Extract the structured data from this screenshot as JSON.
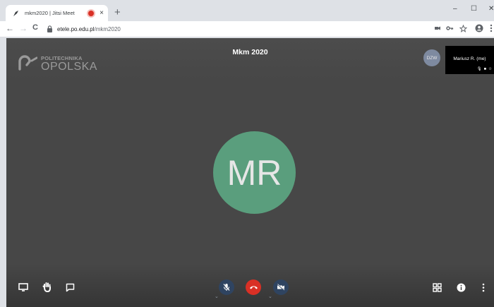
{
  "browser": {
    "tab_title": "mkm2020 | Jitsi Meet",
    "tab_close": "×",
    "new_tab": "+",
    "window_minimize": "–",
    "window_maximize": "☐",
    "window_close": "✕",
    "back": "←",
    "forward": "→",
    "reload": "C",
    "url_host": "etele.po.edu.pl",
    "url_path": "/mkm2020"
  },
  "meeting": {
    "logo_line1": "POLITECHNIKA",
    "logo_line2": "OPOLSKA",
    "title": "Mkm 2020",
    "local_initials": "DZW",
    "thumbnail_name": "Mariusz R. (me)",
    "speaker_initials": "MR"
  },
  "colors": {
    "end_call": "#d93025",
    "avatar_main": "#5a9e7d",
    "control_button": "#2f4461"
  },
  "icons": [
    "share-screen-icon",
    "raise-hand-icon",
    "chat-icon",
    "mic-muted-icon",
    "hangup-icon",
    "camera-off-icon",
    "tile-view-icon",
    "info-icon",
    "more-icon",
    "lock-icon",
    "camera-icon",
    "key-icon",
    "star-icon",
    "account-icon"
  ]
}
